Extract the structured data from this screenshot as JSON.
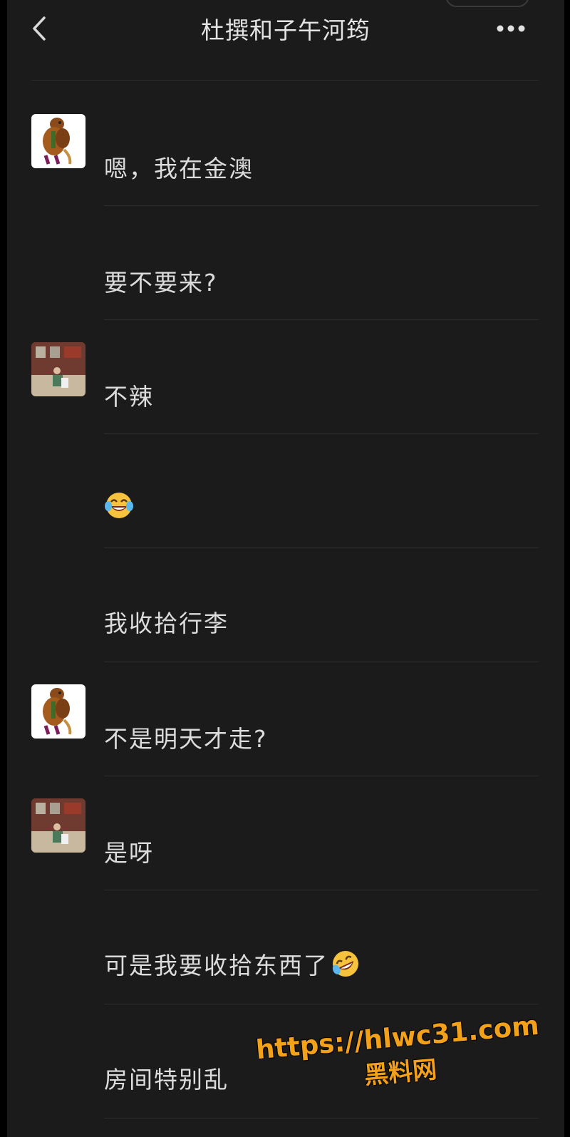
{
  "header": {
    "title": "杜撰和子午河筠",
    "back_icon": "chevron-left-icon",
    "more_icon": "more-horizontal-icon"
  },
  "messages": [
    {
      "avatar": "scooby",
      "text": "嗯，我在金澳"
    },
    {
      "avatar": null,
      "text": "要不要来?"
    },
    {
      "avatar": "room",
      "text": "不辣"
    },
    {
      "avatar": null,
      "text": "",
      "emoji": "face-with-tears-of-joy"
    },
    {
      "avatar": null,
      "text": "我收拾行李"
    },
    {
      "avatar": "scooby",
      "text": "不是明天才走?"
    },
    {
      "avatar": "room",
      "text": "是呀"
    },
    {
      "avatar": null,
      "text": "可是我要收拾东西了",
      "emoji": "rolling-laughing"
    },
    {
      "avatar": null,
      "text": "房间特别乱"
    }
  ],
  "watermark": {
    "url": "https://hlwc31.com",
    "name": "黑料网"
  },
  "colors": {
    "background": "#1b1b1c",
    "text": "#dcdcdc",
    "watermark": "#f4a11a"
  }
}
